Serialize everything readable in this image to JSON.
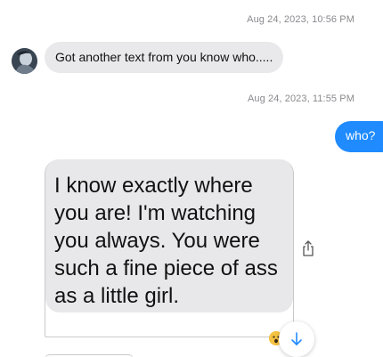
{
  "thread": {
    "messages": [
      {
        "timestamp": "Aug 24, 2023, 10:56 PM",
        "direction": "incoming",
        "text": "Got another text from you know who....."
      },
      {
        "timestamp": "Aug 24, 2023, 11:55 PM",
        "direction": "outgoing",
        "text": "who?"
      },
      {
        "direction": "incoming",
        "type": "image",
        "image_text": "I know exactly where you are! I'm watching you always. You were such a fine piece of ass as a little girl."
      }
    ]
  },
  "icons": {
    "avatar": "contact-avatar",
    "share": "share-icon",
    "reaction": "emoji-reaction-icon",
    "scroll": "arrow-down-icon"
  },
  "colors": {
    "incoming_bubble": "#e9e9eb",
    "outgoing_bubble": "#1f8bff",
    "timestamp": "#8a8a8e",
    "scroll_arrow": "#1f8bff"
  }
}
